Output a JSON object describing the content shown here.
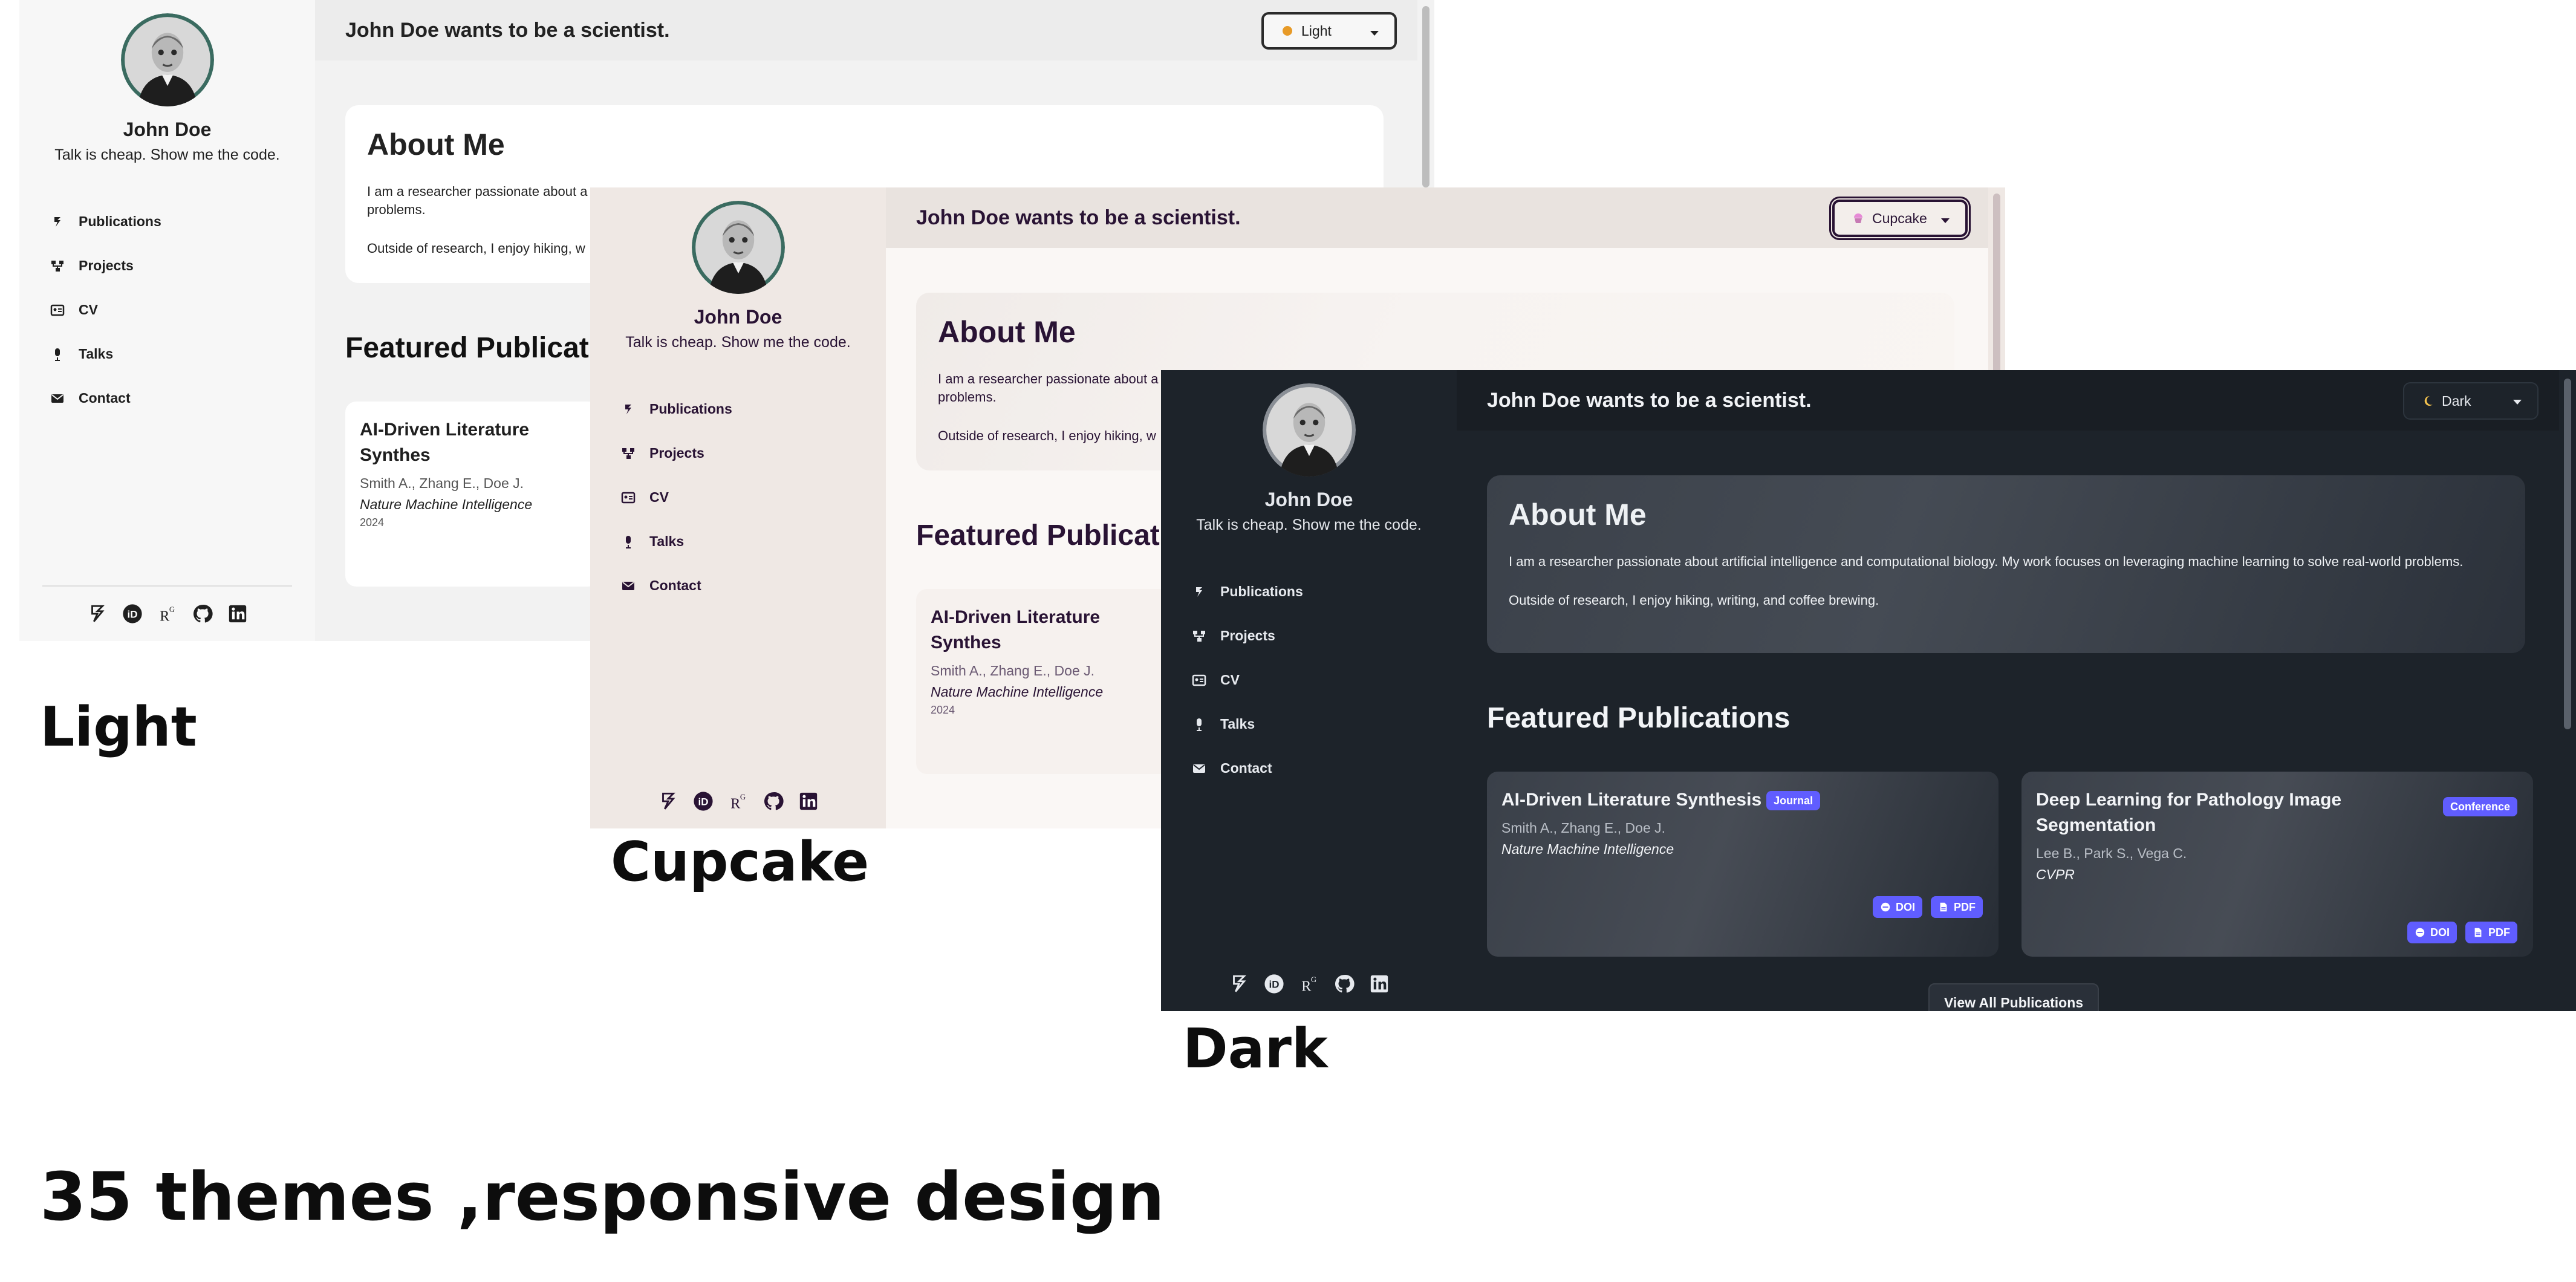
{
  "profile": {
    "name": "John Doe",
    "tagline": "Talk is cheap. Show me the code."
  },
  "nav": [
    {
      "label": "Publications",
      "icon": "scholar-icon"
    },
    {
      "label": "Projects",
      "icon": "projects-icon"
    },
    {
      "label": "CV",
      "icon": "cv-icon"
    },
    {
      "label": "Talks",
      "icon": "microphone-icon"
    },
    {
      "label": "Contact",
      "icon": "envelope-icon"
    }
  ],
  "social": [
    "google-scholar-icon",
    "orcid-icon",
    "researchgate-icon",
    "github-icon",
    "linkedin-icon"
  ],
  "header": {
    "title": "John Doe wants to be a scientist."
  },
  "about": {
    "heading": "About Me",
    "p1": "I am a researcher passionate about artificial intelligence and computational biology. My work focuses on leveraging machine learning to solve real-world problems.",
    "p2": "Outside of research, I enjoy hiking, writing, and coffee brewing.",
    "p1_cut": "I am a researcher passionate about a",
    "p1_cut_tail": "problems.",
    "p2_cut": "Outside of research, I enjoy hiking, w"
  },
  "featured": {
    "heading": "Featured Publications",
    "heading_cut": "Featured Publicati"
  },
  "publications": [
    {
      "title": "AI-Driven Literature Synthesis",
      "title_cut": "AI-Driven Literature Synthes",
      "badge": "Journal",
      "authors": "Smith A., Zhang E., Doe J.",
      "venue": "Nature Machine Intelligence",
      "year": "2024",
      "buttons": [
        "DOI",
        "PDF"
      ]
    },
    {
      "title": "Deep Learning for Pathology Image Segmentation",
      "badge": "Conference",
      "authors": "Lee B., Park S., Vega C.",
      "venue": "CVPR",
      "buttons": [
        "DOI",
        "PDF"
      ]
    }
  ],
  "view_all": "View All Publications",
  "themes": {
    "light": {
      "label": "Light",
      "caption": "Light"
    },
    "cupcake": {
      "label": "Cupcake",
      "caption": "Cupcake"
    },
    "dark": {
      "label": "Dark",
      "caption": "Dark"
    }
  },
  "caption_main": "35 themes ,responsive design",
  "colors": {
    "dark_accent": "#605dff",
    "cupcake_text": "#291334",
    "light_bg": "#f2f2f2",
    "dark_bg": "#1d232a"
  }
}
